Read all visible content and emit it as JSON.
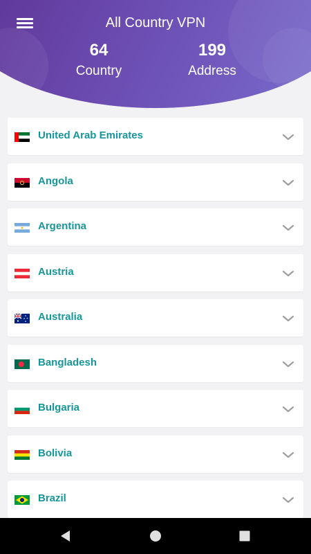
{
  "header": {
    "title": "All Country VPN",
    "stats": {
      "country_count": "64",
      "country_label": "Country",
      "address_count": "199",
      "address_label": "Address"
    }
  },
  "countries": [
    {
      "name": "United Arab Emirates",
      "flag": "uae-flag"
    },
    {
      "name": "Angola",
      "flag": "angola-flag"
    },
    {
      "name": "Argentina",
      "flag": "argentina-flag"
    },
    {
      "name": "Austria",
      "flag": "austria-flag"
    },
    {
      "name": "Australia",
      "flag": "australia-flag"
    },
    {
      "name": "Bangladesh",
      "flag": "bangladesh-flag"
    },
    {
      "name": "Bulgaria",
      "flag": "bulgaria-flag"
    },
    {
      "name": "Bolivia",
      "flag": "bolivia-flag"
    },
    {
      "name": "Brazil",
      "flag": "brazil-flag"
    }
  ],
  "colors": {
    "header_gradient_start": "#5a2f8f",
    "header_gradient_end": "#7a6fd0",
    "country_text": "#17969a",
    "chevron": "#9e9e9e",
    "background": "#f2f2f4"
  },
  "icons": {
    "menu": "menu-icon",
    "expand": "chevron-down-icon",
    "nav_back": "back-triangle-icon",
    "nav_home": "home-circle-icon",
    "nav_recent": "recent-square-icon"
  }
}
